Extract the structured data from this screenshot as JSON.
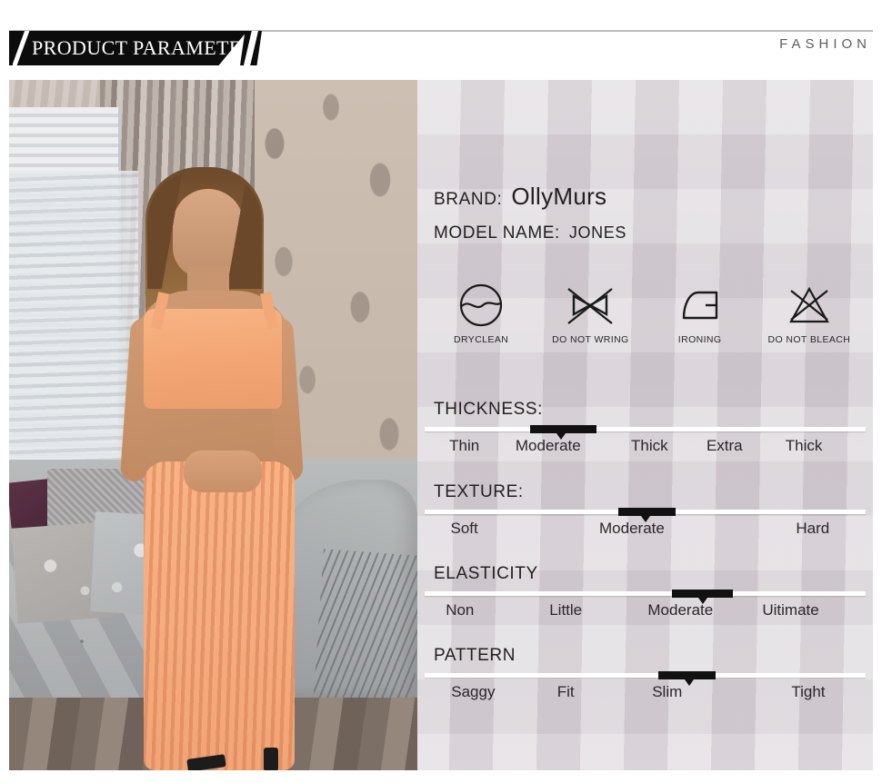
{
  "header": {
    "banner_title": "PRODUCT PARAMETERS",
    "brand_word": "FASHION"
  },
  "product": {
    "brand_label": "BRAND:",
    "brand_value": "OllyMurs",
    "model_label": "MODEL NAME:",
    "model_value": "JONES"
  },
  "care_instructions": [
    {
      "icon": "dryclean-icon",
      "label": "DRYCLEAN"
    },
    {
      "icon": "do-not-wring-icon",
      "label": "DO NOT WRING"
    },
    {
      "icon": "ironing-icon",
      "label": "IRONING"
    },
    {
      "icon": "do-not-bleach-icon",
      "label": "DO NOT BLEACH"
    }
  ],
  "specs": [
    {
      "title": "THICKNESS:",
      "options": [
        "Thin",
        "Moderate",
        "Thick",
        "Extra",
        "Thick"
      ],
      "positions": [
        9,
        28,
        51,
        68,
        86
      ],
      "selected_index": 1,
      "marker_start_pct": 24,
      "marker_end_pct": 39,
      "pointer_pct": 31
    },
    {
      "title": "TEXTURE:",
      "options": [
        "Soft",
        "Moderate",
        "Hard"
      ],
      "positions": [
        9,
        47,
        88
      ],
      "selected_index": 1,
      "marker_start_pct": 44,
      "marker_end_pct": 57,
      "pointer_pct": 50
    },
    {
      "title": "ELASTICITY",
      "options": [
        "Non",
        "Little",
        "Moderate",
        "Uitimate"
      ],
      "positions": [
        8,
        32,
        58,
        83
      ],
      "selected_index": 2,
      "marker_start_pct": 56,
      "marker_end_pct": 70,
      "pointer_pct": 63
    },
    {
      "title": "PATTERN",
      "options": [
        "Saggy",
        "Fit",
        "Slim",
        "Tight"
      ],
      "positions": [
        11,
        32,
        55,
        87
      ],
      "selected_index": 2,
      "marker_start_pct": 53,
      "marker_end_pct": 66,
      "pointer_pct": 60
    }
  ],
  "photo": {
    "alt": "model-wearing-peach-crop-top-and-ribbed-midi-skirt-set"
  },
  "colors": {
    "banner_bg": "#0c0c0c",
    "panel_bg": "#d4cdd4",
    "bar": "#ffffff",
    "marker": "#111111",
    "text": "#231f20",
    "garment": "#f3a97b"
  }
}
